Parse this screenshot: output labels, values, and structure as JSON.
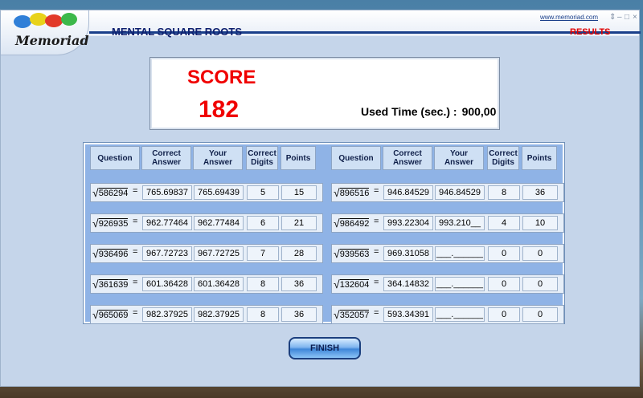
{
  "app": {
    "website": "www.memoriad.com",
    "logo_text": "Memoriad",
    "title": "MENTAL SQUARE ROOTS",
    "results_label": "RESULTS",
    "window_controls": [
      "⇕",
      "–",
      "□",
      "×"
    ]
  },
  "score": {
    "label": "SCORE",
    "value": "182",
    "used_time_label": "Used Time (sec.) :",
    "used_time_value": "900,00"
  },
  "table": {
    "headers": {
      "question": "Question",
      "correct_answer": "Correct Answer",
      "your_answer": "Your Answer",
      "correct_digits": "Correct Digits",
      "points": "Points"
    },
    "left_rows": [
      {
        "radicand": "586294",
        "correct": "765.69837",
        "yours": "765.69439",
        "digits": "5",
        "points": "15"
      },
      {
        "radicand": "926935",
        "correct": "962.77464",
        "yours": "962.77484",
        "digits": "6",
        "points": "21"
      },
      {
        "radicand": "936496",
        "correct": "967.72723",
        "yours": "967.72725",
        "digits": "7",
        "points": "28"
      },
      {
        "radicand": "361639",
        "correct": "601.36428",
        "yours": "601.36428",
        "digits": "8",
        "points": "36"
      },
      {
        "radicand": "965069",
        "correct": "982.37925",
        "yours": "982.37925",
        "digits": "8",
        "points": "36"
      }
    ],
    "right_rows": [
      {
        "radicand": "896516",
        "correct": "946.84529",
        "yours": "946.84529",
        "digits": "8",
        "points": "36"
      },
      {
        "radicand": "986492",
        "correct": "993.22304",
        "yours": "993.210__",
        "digits": "4",
        "points": "10"
      },
      {
        "radicand": "939563",
        "correct": "969.31058",
        "yours": "___.______",
        "digits": "0",
        "points": "0"
      },
      {
        "radicand": "132604",
        "correct": "364.14832",
        "yours": "___.______",
        "digits": "0",
        "points": "0"
      },
      {
        "radicand": "352057",
        "correct": "593.34391",
        "yours": "___.______",
        "digits": "0",
        "points": "0"
      }
    ]
  },
  "buttons": {
    "finish": "FINISH"
  },
  "symbols": {
    "equals": "=",
    "radical": "√"
  }
}
